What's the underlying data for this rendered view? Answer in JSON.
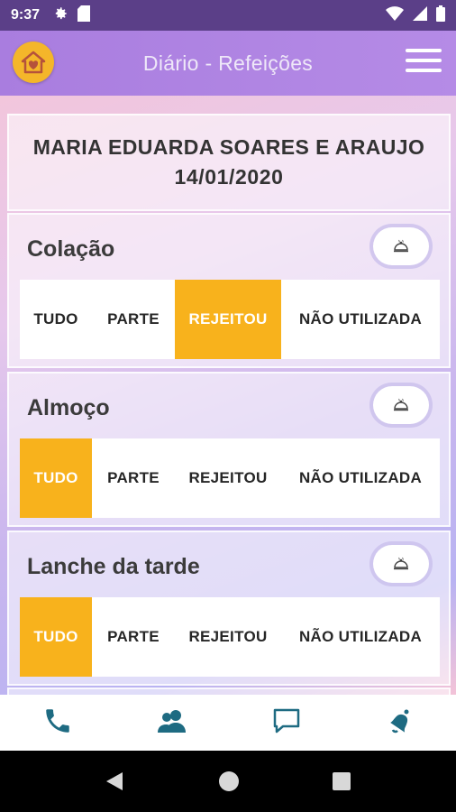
{
  "status": {
    "time": "9:37",
    "icons": [
      "gear-icon",
      "sd-card-icon",
      "wifi-icon",
      "signal-icon",
      "battery-icon"
    ]
  },
  "appbar": {
    "title": "Diário - Refeições",
    "left_icon": "home-heart-icon",
    "right_icon": "hamburger-menu-icon"
  },
  "student": {
    "name": "MARIA EDUARDA SOARES E ARAUJO",
    "date": "14/01/2020"
  },
  "option_labels": [
    "TUDO",
    "PARTE",
    "REJEITOU",
    "NÃO UTILIZADA"
  ],
  "meals": [
    {
      "title": "Colação",
      "selected": "REJEITOU",
      "options": [
        "TUDO",
        "PARTE",
        "REJEITOU",
        "NÃO UTILIZADA"
      ]
    },
    {
      "title": "Almoço",
      "selected": "TUDO",
      "options": [
        "TUDO",
        "PARTE",
        "REJEITOU",
        "NÃO UTILIZADA"
      ]
    },
    {
      "title": "Lanche da tarde",
      "selected": "TUDO",
      "options": [
        "TUDO",
        "PARTE",
        "REJEITOU",
        "NÃO UTILIZADA"
      ]
    }
  ],
  "bottom_nav": [
    "phone-icon",
    "contacts-icon",
    "chat-icon",
    "notification-bell-icon"
  ],
  "colors": {
    "accent": "#f8b21c",
    "appbar": "#a97ddf",
    "nav_icon": "#1e6b82"
  }
}
